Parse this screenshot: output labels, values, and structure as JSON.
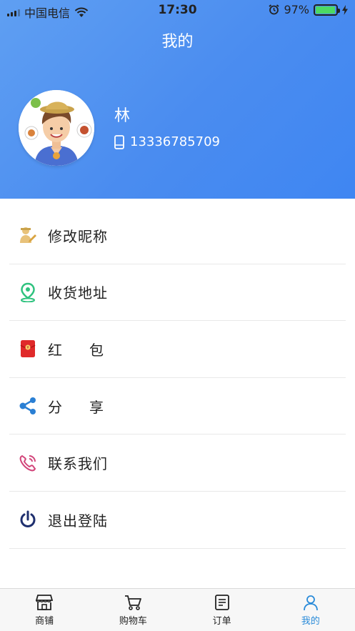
{
  "status_bar": {
    "carrier": "中国电信",
    "time": "17:30",
    "battery": "97%",
    "battery_level": 0.97
  },
  "header": {
    "title": "我的",
    "user_name": "林",
    "phone": "13336785709"
  },
  "menu": {
    "items": [
      {
        "label": "修改昵称",
        "icon": "edit-nickname-icon"
      },
      {
        "label": "收货地址",
        "icon": "location-pin-icon"
      },
      {
        "label": "红包",
        "icon": "red-envelope-icon"
      },
      {
        "label": "分享",
        "icon": "share-icon"
      },
      {
        "label": "联系我们",
        "icon": "phone-contact-icon"
      },
      {
        "label": "退出登陆",
        "icon": "power-icon"
      }
    ]
  },
  "tabbar": {
    "tabs": [
      {
        "label": "商铺",
        "icon": "store-icon"
      },
      {
        "label": "购物车",
        "icon": "cart-icon"
      },
      {
        "label": "订单",
        "icon": "order-list-icon"
      },
      {
        "label": "我的",
        "icon": "user-icon"
      }
    ],
    "active_index": 3
  },
  "colors": {
    "header_bg": "#4a8cf0",
    "active_tab": "#2a8bd9",
    "battery_fill": "#4cd964",
    "red_envelope": "#e02a2a",
    "location_green": "#2ec27e",
    "share_blue": "#2a7fd4",
    "contact_pink": "#d2457a",
    "power_navy": "#1e2f6e"
  }
}
